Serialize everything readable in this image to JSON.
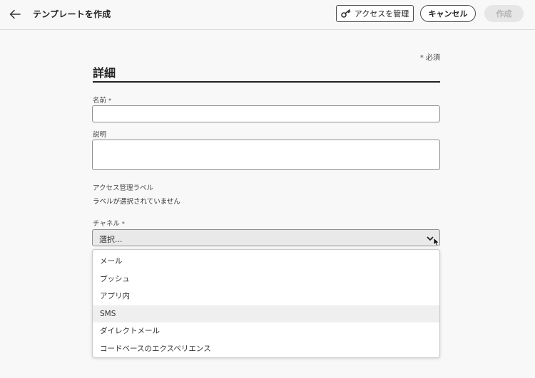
{
  "header": {
    "title": "テンプレートを作成",
    "access_label": "アクセスを管理",
    "cancel_label": "キャンセル",
    "create_label": "作成"
  },
  "form": {
    "required_note": "* 必須",
    "section_title": "詳細",
    "name_label": "名前",
    "description_label": "説明",
    "access_labels_label": "アクセス管理ラベル",
    "access_labels_value": "ラベルが選択されていません",
    "channel_label": "チャネル",
    "channel_placeholder": "選択...",
    "required_star": "*"
  },
  "channel_options": [
    "メール",
    "プッシュ",
    "アプリ内",
    "SMS",
    "ダイレクトメール",
    "コードベースのエクスペリエンス"
  ],
  "hovered_option": 3,
  "icons": {
    "back": "arrow-left-icon",
    "access": "key-icon",
    "chevron": "chevron-down-icon",
    "cursor": "mouse-pointer-icon"
  },
  "colors": {
    "background": "#f8f8f8",
    "text": "#2c2c2c",
    "disabled_button": "#e6e6e6",
    "hover_row": "#efefef"
  }
}
